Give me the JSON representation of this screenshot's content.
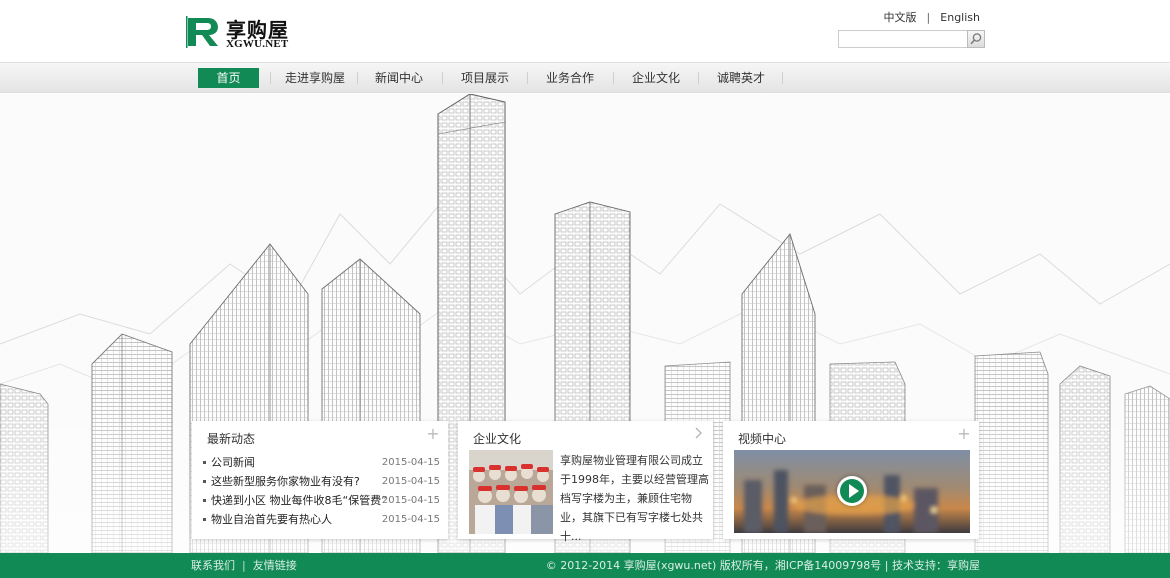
{
  "header": {
    "logo_cn": "享购屋",
    "logo_en": "XGWU.NET",
    "lang_cn": "中文版",
    "lang_sep": "|",
    "lang_en": "English",
    "search_placeholder": ""
  },
  "nav": {
    "items": [
      {
        "label": "首页"
      },
      {
        "label": "走进享购屋"
      },
      {
        "label": "新闻中心"
      },
      {
        "label": "项目展示"
      },
      {
        "label": "业务合作"
      },
      {
        "label": "企业文化"
      },
      {
        "label": "诚聘英才"
      }
    ]
  },
  "news": {
    "title": "最新动态",
    "items": [
      {
        "text": "公司新闻",
        "date": "2015-04-15"
      },
      {
        "text": "这些新型服务你家物业有没有?",
        "date": "2015-04-15"
      },
      {
        "text": "快递到小区 物业每件收8毛“保管费”",
        "date": "2015-04-15"
      },
      {
        "text": "物业自治首先要有热心人",
        "date": "2015-04-15"
      }
    ]
  },
  "culture": {
    "title": "企业文化",
    "text": "享购屋物业管理有限公司成立于1998年，主要以经营管理高档写字楼为主，兼顾住宅物业，其旗下已有写字楼七处共十..."
  },
  "video": {
    "title": "视频中心"
  },
  "footer": {
    "contact": "联系我们",
    "sep": "|",
    "links": "友情链接",
    "copyright": "© 2012-2014 享购屋(xgwu.net) 版权所有，湘ICP备14009798号 | 技术支持：享购屋"
  },
  "colors": {
    "brand_green": "#128a56"
  },
  "icons": {
    "search": "magnifier-icon",
    "more": "plus-icon",
    "arrow": "chevron-right-icon",
    "play": "play-icon"
  }
}
